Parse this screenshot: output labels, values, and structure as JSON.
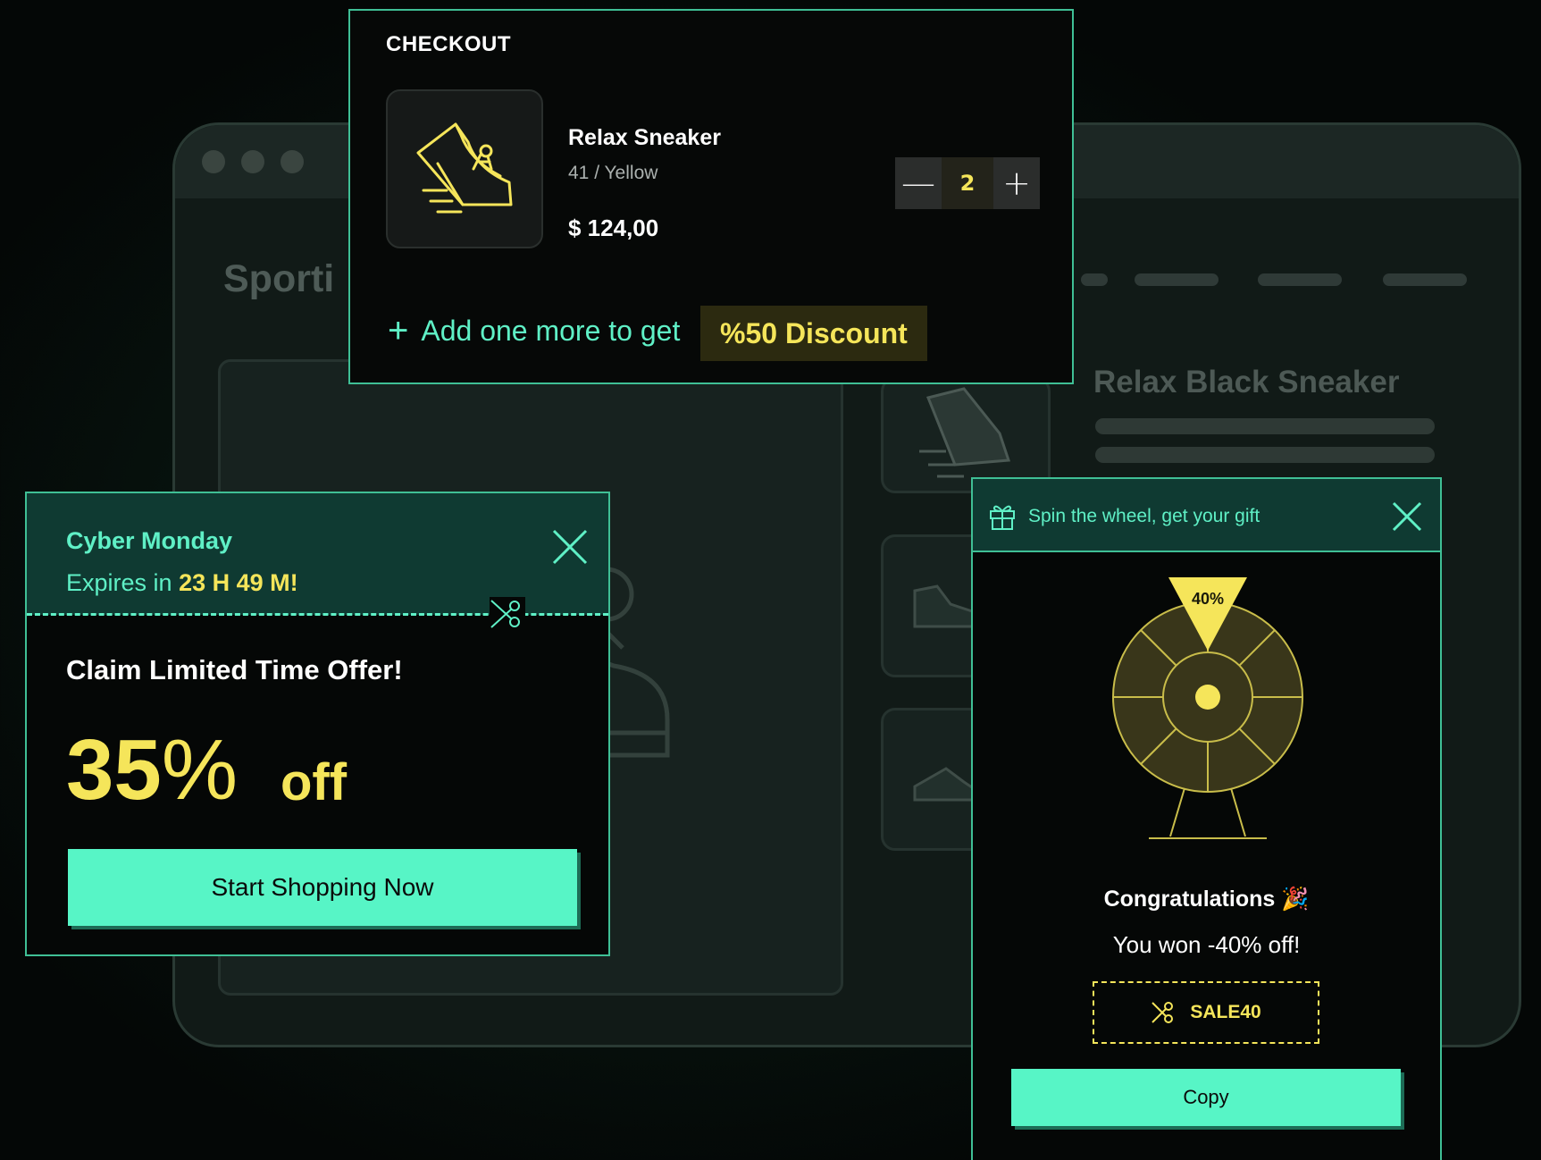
{
  "background": {
    "site_title": "Sporti",
    "product_title": "Relax Black Sneaker"
  },
  "checkout": {
    "title": "CHECKOUT",
    "product_name": "Relax Sneaker",
    "product_variant": "41  / Yellow",
    "product_price": "$ 124,00",
    "quantity": "2",
    "decrement_label": "—",
    "increment_label": "+",
    "upsell_text": "Add one more to get",
    "discount_label": "%50 Discount"
  },
  "cyber": {
    "title": "Cyber Monday",
    "expires_prefix": "Expires in",
    "expires_value": "23 H 49 M!",
    "claim_text": "Claim Limited Time Offer!",
    "discount_number": "35",
    "discount_symbol": "%",
    "off_text": "off",
    "cta_label": "Start Shopping Now"
  },
  "spin": {
    "title": "Spin the wheel, get your gift",
    "pointer_label": "40%",
    "congrats_text": "Congratulations",
    "congrats_emoji": "🎉",
    "won_text": "You won -40% off!",
    "coupon_code": "SALE40",
    "copy_label": "Copy"
  },
  "colors": {
    "accent_mint": "#57f5c6",
    "accent_yellow": "#f5e55a",
    "panel_teal": "#0f3a32",
    "border": "#3fbf95"
  },
  "icons": [
    "sneaker-icon",
    "close-icon",
    "scissors-icon",
    "gift-icon",
    "plus-icon",
    "minus-icon",
    "prize-wheel"
  ]
}
